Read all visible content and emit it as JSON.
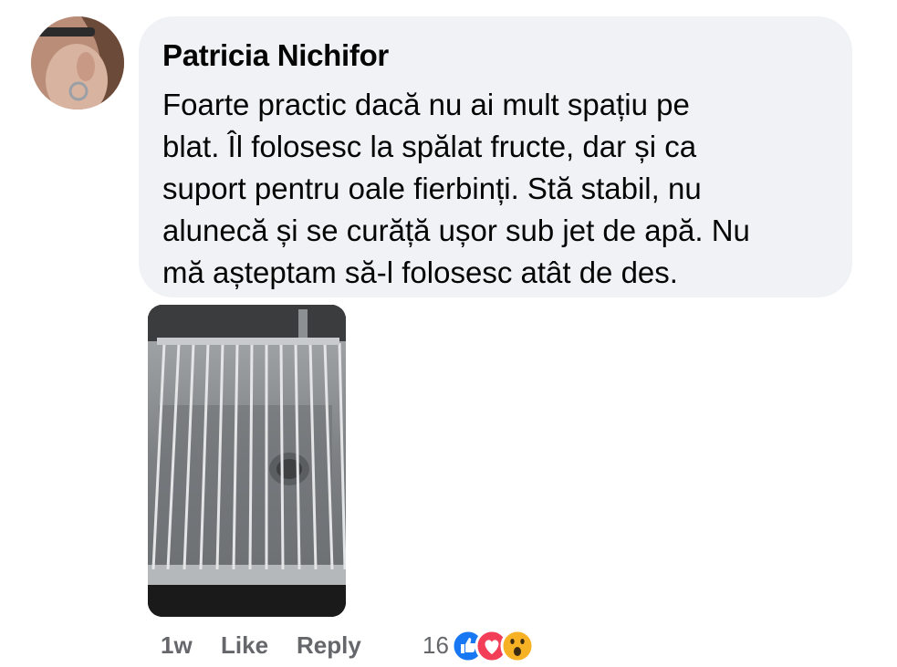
{
  "comment": {
    "author": "Patricia Nichifor",
    "text": "Foarte practic dacă nu ai mult spațiu pe\nblat. Îl folosesc la spălat fructe, dar și ca\nsuport pentru oale fierbinți. Stă stabil, nu\nalunecă și se curăță ușor sub jet de apă. Nu\nmă așteptam să-l folosesc atât de des."
  },
  "actions": {
    "time": "1w",
    "like_label": "Like",
    "reply_label": "Reply"
  },
  "reactions": {
    "count": "16",
    "icons": [
      "like-reaction-icon",
      "love-reaction-icon",
      "wow-reaction-icon"
    ]
  },
  "colors": {
    "bubble": "#f0f2f5",
    "meta_text": "#65676b",
    "like_blue": "#1877f2",
    "love_red": "#f33e58",
    "wow_yellow": "#f7b125"
  }
}
